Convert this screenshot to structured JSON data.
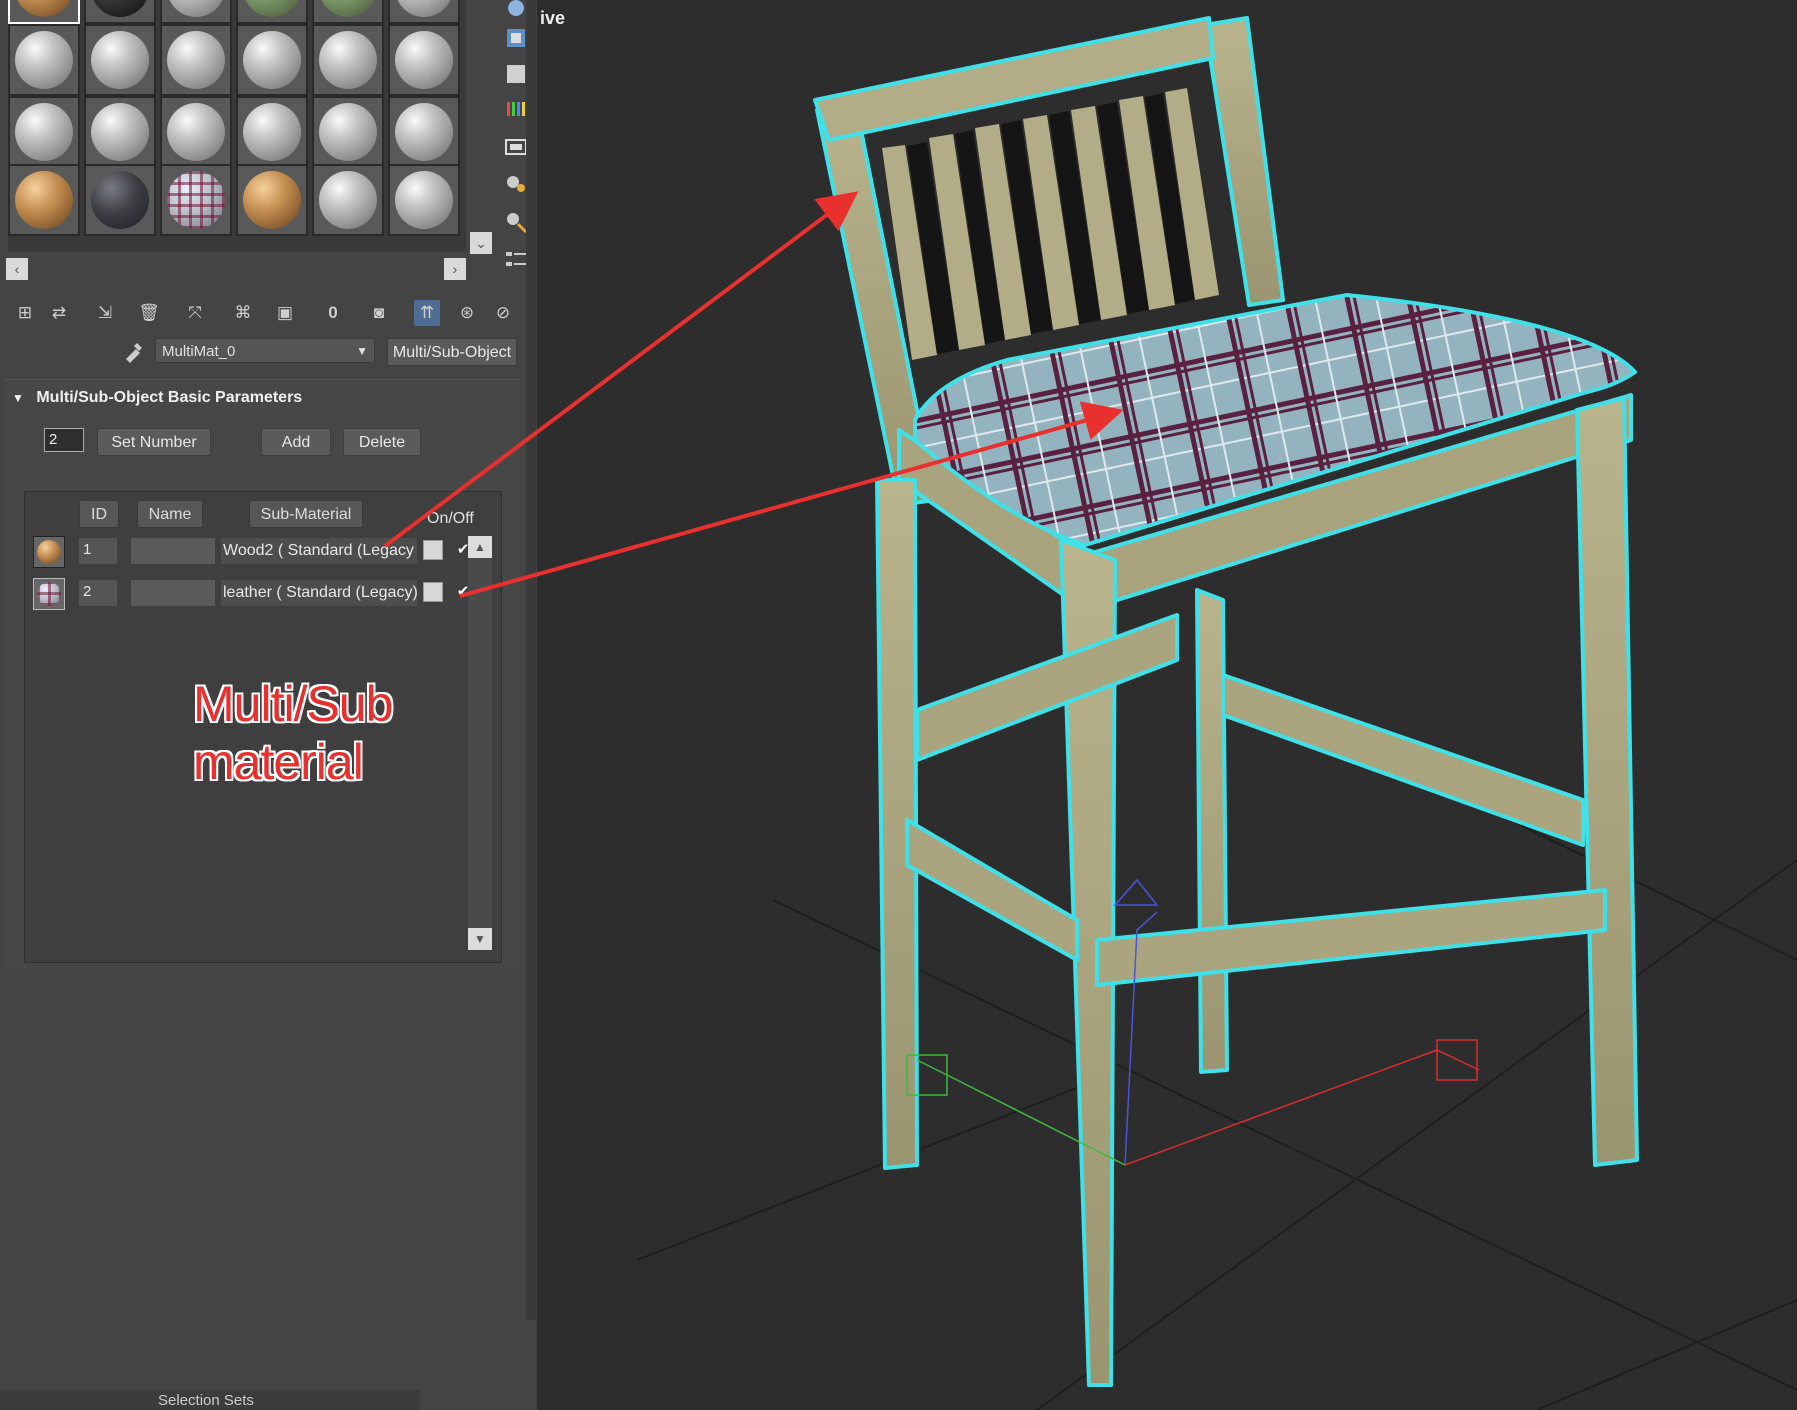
{
  "material_editor": {
    "slot_rows": [
      [
        "wood",
        "black",
        "gray",
        "green",
        "green",
        "gray"
      ],
      [
        "gray",
        "gray",
        "gray",
        "gray",
        "gray",
        "gray"
      ],
      [
        "gray",
        "gray",
        "gray",
        "gray",
        "gray",
        "gray"
      ],
      [
        "wood",
        "dark",
        "plaid",
        "wood",
        "gray",
        "gray"
      ]
    ],
    "material_name": "MultiMat_0",
    "material_type": "Multi/Sub-Object",
    "rollout_title": "Multi/Sub-Object Basic Parameters",
    "number_value": "2",
    "set_number_label": "Set Number",
    "add_label": "Add",
    "delete_label": "Delete",
    "columns": {
      "id": "ID",
      "name": "Name",
      "sub_material": "Sub-Material",
      "on_off": "On/Off"
    },
    "rows": [
      {
        "id": "1",
        "name": "",
        "sub_material": "Wood2  ( Standard (Legacy",
        "thumb": "wood",
        "enabled": true
      },
      {
        "id": "2",
        "name": "",
        "sub_material": "leather  ( Standard (Legacy)",
        "thumb": "plaid",
        "enabled": true
      }
    ]
  },
  "annotation": "Multi/Sub material",
  "viewport": {
    "label": "ive"
  },
  "bottom": {
    "selection_sets": "Selection Sets"
  },
  "colors": {
    "selection_outline": "#3fe0e8",
    "annotation_red": "#e8302f",
    "panel": "#444444",
    "viewport_bg": "#2d2d2d"
  }
}
